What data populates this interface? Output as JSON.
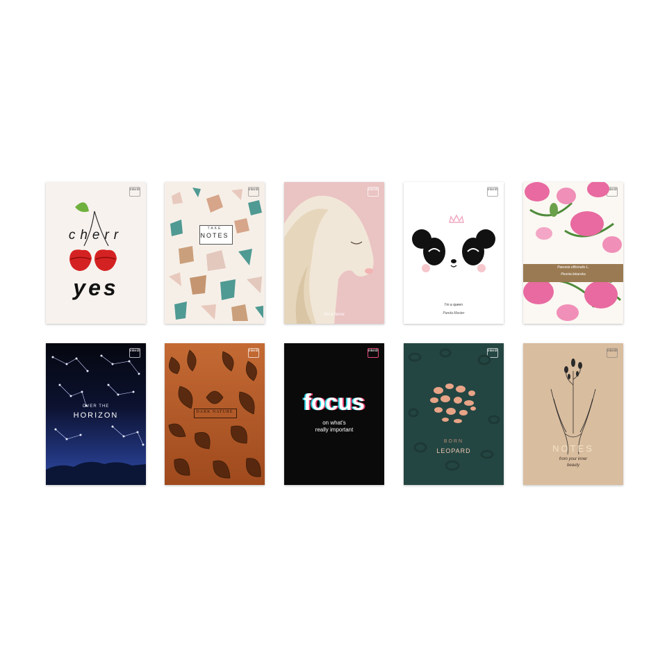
{
  "brand_logo": "interdruk",
  "covers": [
    {
      "name": "cherry-cover",
      "bg": "#f7f2ee",
      "line1": "cherr",
      "line2": "yes"
    },
    {
      "name": "terrazzo-cover",
      "bg": "#f6efe8",
      "small": "TAKE",
      "title": "NOTES"
    },
    {
      "name": "unicorn-cover",
      "bg": "#eac3c3",
      "signature": "I'm a horse"
    },
    {
      "name": "panda-cover",
      "bg": "#ffffff",
      "small": "I'm a queen",
      "signature": "Panda Master"
    },
    {
      "name": "peony-cover",
      "bg": "#fbf7f2",
      "label1": "Paeonia officinalis L.",
      "label2": "Peonia lekarska"
    },
    {
      "name": "horizon-cover",
      "bg": "#0c1230",
      "small": "OVER THE",
      "title": "HORIZON"
    },
    {
      "name": "moth-cover",
      "bg": "#b55a2a",
      "title": "DARK NATURE"
    },
    {
      "name": "focus-cover",
      "bg": "#0a0a0a",
      "title": "focus",
      "sub1": "on what's",
      "sub2": "really important"
    },
    {
      "name": "leopard-cover",
      "bg": "#244642",
      "small": "BORN",
      "title": "LEOPARD"
    },
    {
      "name": "hands-cover",
      "bg": "#d9bd9f",
      "title": "NOTES",
      "sub1": "from your inner",
      "sub2": "beauty"
    }
  ],
  "colors": {
    "cherry_red": "#d42222",
    "terrazzo_teal": "#4f9a93",
    "unicorn_cream": "#f1e7d8",
    "peony_pink": "#e86aa0",
    "star_white": "#e8ecff",
    "rose_gold": "#e8a487",
    "gold": "#c8a46a"
  }
}
